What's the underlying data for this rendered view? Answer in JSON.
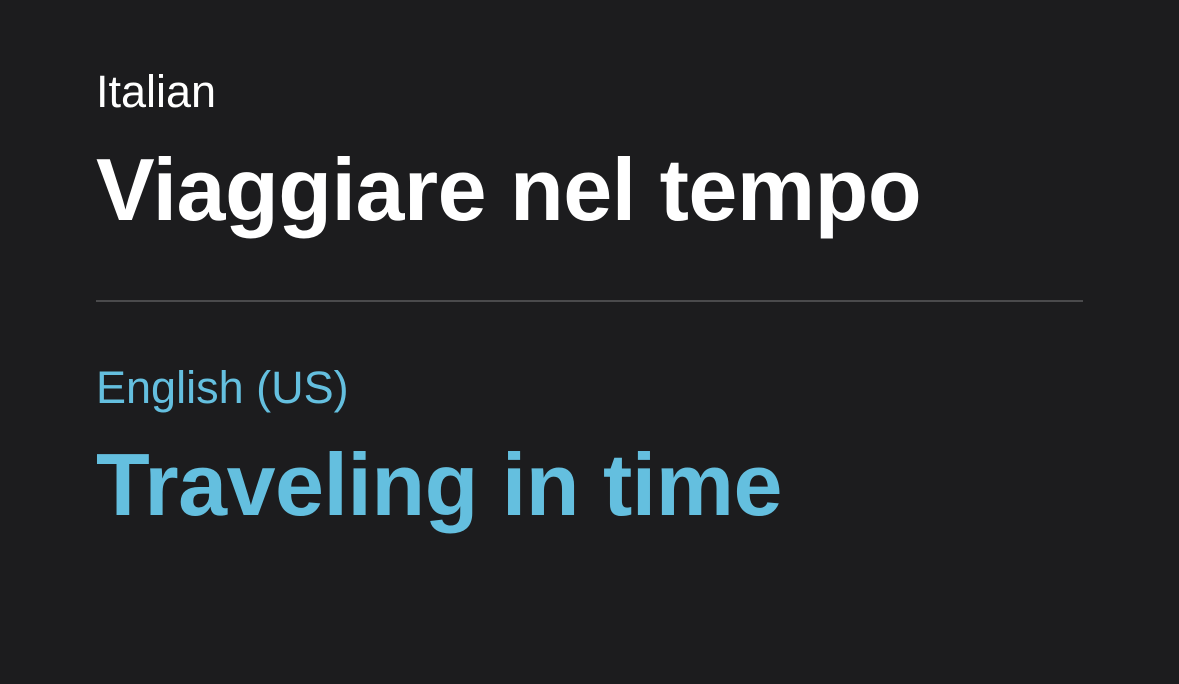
{
  "source": {
    "language": "Italian",
    "text": "Viaggiare nel tempo"
  },
  "target": {
    "language": "English (US)",
    "text": "Traveling in time"
  },
  "colors": {
    "background": "#1c1c1e",
    "source_text": "#ffffff",
    "target_accent": "#64bfdf",
    "divider": "#4a4a4c"
  }
}
